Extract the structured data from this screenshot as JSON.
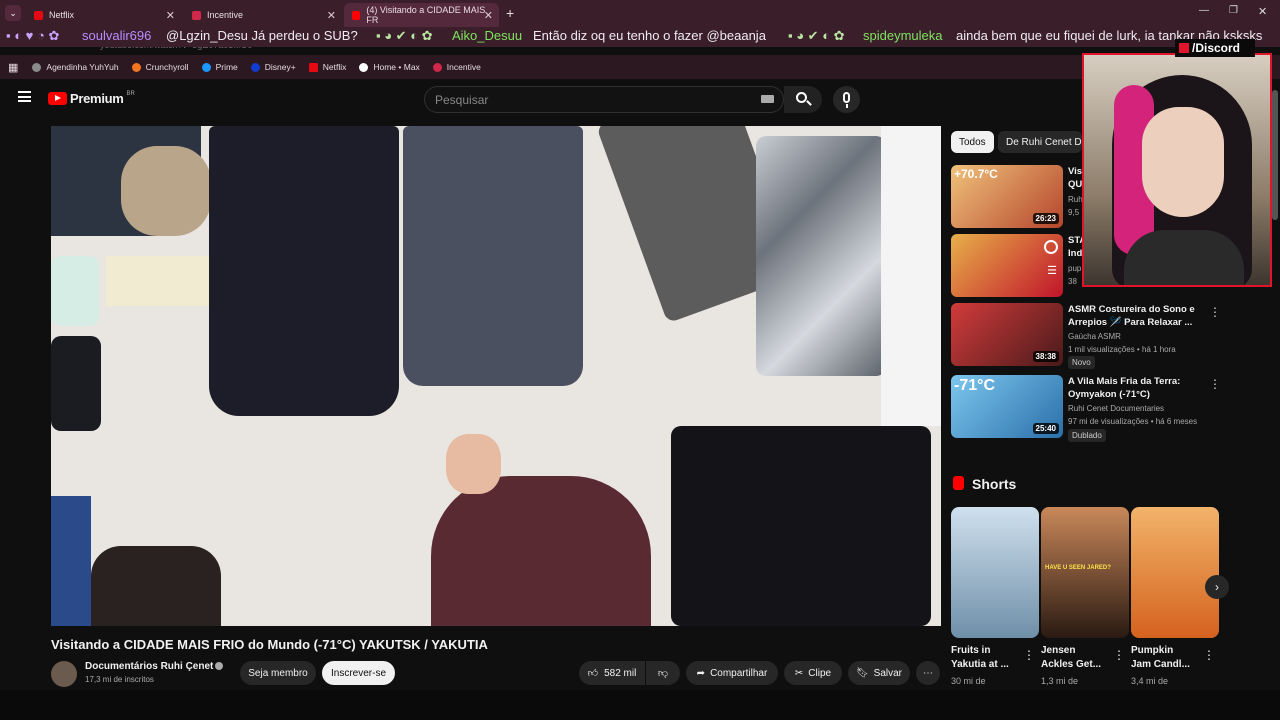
{
  "browser": {
    "tabs": [
      {
        "label": "Netflix",
        "color": "#e50914"
      },
      {
        "label": "Incentive",
        "color": "#d1274b"
      },
      {
        "label": "(4) Visitando a CIDADE MAIS FR",
        "color": "#ff0000"
      }
    ],
    "new_tab": "+",
    "url": "youtube.com/watch?v=3gE07a03MU0",
    "bookmarks": [
      "Agendinha YuhYuh",
      "Crunchyroll",
      "Prime",
      "Disney+",
      "Netflix",
      "Home • Max",
      "Incentive"
    ]
  },
  "chat": {
    "messages": [
      {
        "user": "soulvalir696",
        "user_color": "#b98cff",
        "text": "@Lgzin_Desu Já perdeu o SUB?"
      },
      {
        "user": "Aiko_Desuu",
        "user_color": "#7ee35e",
        "text": "Então diz oq eu tenho o fazer @beaanja"
      },
      {
        "user": "spideymuleka",
        "user_color": "#7ee35e",
        "text": "ainda bem que eu fiquei de lurk, ia tankar não ksksks"
      }
    ]
  },
  "youtube": {
    "logo": "Premium",
    "region": "BR",
    "search_placeholder": "Pesquisar",
    "video": {
      "title": "Visitando a CIDADE MAIS FRIO do Mundo (-71°C) YAKUTSK / YAKUTIA",
      "channel": "Documentários Ruhi Çenet",
      "subscribers": "17,3 mi de inscritos",
      "join": "Seja membro",
      "subscribe": "Inscrever-se",
      "likes": "582 mil",
      "share": "Compartilhar",
      "clip": "Clipe",
      "save": "Salvar"
    },
    "chips": [
      "Todos",
      "De Ruhi Cenet Doc"
    ],
    "related": [
      {
        "title1": "Vis",
        "title2": "QU",
        "meta1": "Ruh",
        "meta2": "9,5",
        "duration": "26:23",
        "thumb_text": "+70.7°C"
      },
      {
        "title1": "STA",
        "title2": "Ind",
        "meta1": "pup",
        "meta2": "38",
        "duration": "",
        "thumb_text": ""
      },
      {
        "title1": "ASMR Costureira do Sono e",
        "title2": "Arrepios 🪡 Para Relaxar ...",
        "meta1": "Gaúcha ASMR",
        "meta2": "1 mil visualizações • há 1 hora",
        "duration": "38:38",
        "badge": "Novo",
        "thumb_text": ""
      },
      {
        "title1": "A Vila Mais Fria da Terra:",
        "title2": "Oymyakon (-71°C)",
        "meta1": "Ruhi Cenet Documentaries",
        "meta2": "97 mi de visualizações • há 6 meses",
        "duration": "25:40",
        "badge": "Dublado",
        "thumb_text": "-71°C"
      }
    ],
    "shorts_label": "Shorts",
    "shorts": [
      {
        "title1": "Fruits in",
        "title2": "Yakutia at ...",
        "views": "30 mi de"
      },
      {
        "title1": "Jensen",
        "title2": "Ackles Get...",
        "views": "1,3 mi de",
        "thumb_text": "HAVE U SEEN JARED?"
      },
      {
        "title1": "Pumpkin",
        "title2": "Jam Candl...",
        "views": "3,4 mi de"
      }
    ]
  },
  "overlay": {
    "discord": "/Discord"
  }
}
